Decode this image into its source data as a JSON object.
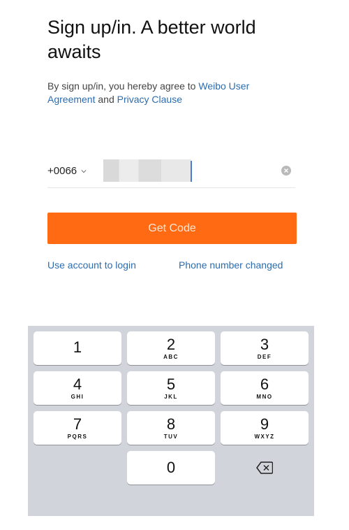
{
  "header": {
    "title": "Sign up/in. A better world awaits",
    "agree_prefix": "By sign up/in, you hereby agree to ",
    "agreement_link": "Weibo User Agreement",
    "and": " and ",
    "privacy_link": "Privacy Clause"
  },
  "form": {
    "country_code": "+0066",
    "phone_value": "",
    "get_code_label": "Get Code",
    "account_login_label": "Use account to login",
    "phone_changed_label": "Phone number changed"
  },
  "keypad": {
    "keys": [
      {
        "num": "1",
        "letters": ""
      },
      {
        "num": "2",
        "letters": "ABC"
      },
      {
        "num": "3",
        "letters": "DEF"
      },
      {
        "num": "4",
        "letters": "GHI"
      },
      {
        "num": "5",
        "letters": "JKL"
      },
      {
        "num": "6",
        "letters": "MNO"
      },
      {
        "num": "7",
        "letters": "PQRS"
      },
      {
        "num": "8",
        "letters": "TUV"
      },
      {
        "num": "9",
        "letters": "WXYZ"
      },
      {
        "num": "0",
        "letters": ""
      }
    ],
    "backspace_icon": "backspace-icon"
  },
  "colors": {
    "accent": "#ff6a13",
    "link": "#2b6cb0",
    "keypad_bg": "#d1d4da"
  }
}
